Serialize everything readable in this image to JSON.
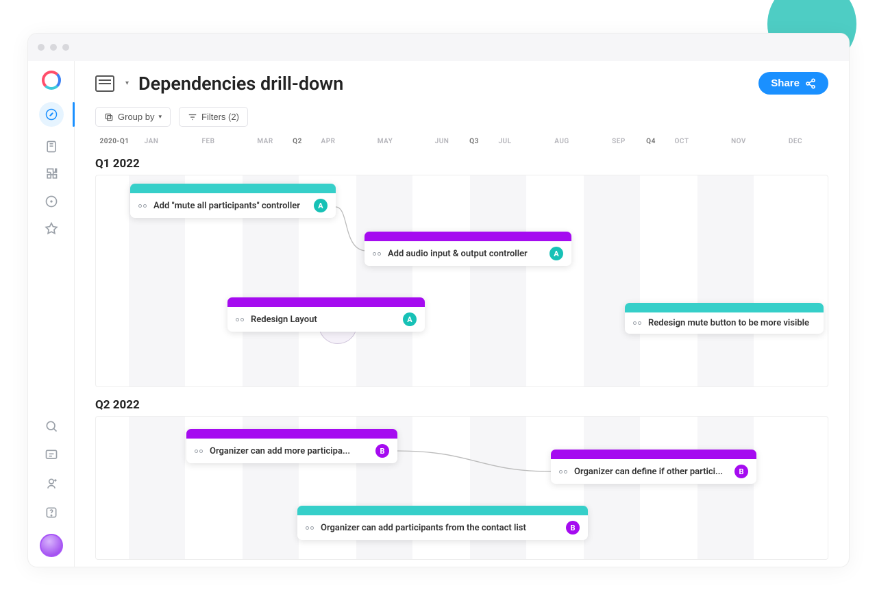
{
  "page": {
    "title": "Dependencies drill-down"
  },
  "share": {
    "label": "Share"
  },
  "toolbar": {
    "group_by": "Group by",
    "filters": "Filters (2)"
  },
  "timeline": {
    "year_label": "2020-Q1",
    "months": [
      "JAN",
      "FEB",
      "MAR",
      "APR",
      "MAY",
      "JUN",
      "JUL",
      "AUG",
      "SEP",
      "OCT",
      "NOV",
      "DEC"
    ],
    "quarters": [
      "Q2",
      "Q3",
      "Q4"
    ]
  },
  "sections": {
    "q1": {
      "label": "Q1 2022"
    },
    "q2": {
      "label": "Q2 2022"
    }
  },
  "cards": {
    "c1": {
      "title": "Add \"mute all participants\" controller",
      "badge": "A"
    },
    "c2": {
      "title": "Add audio input & output controller",
      "badge": "A"
    },
    "c3": {
      "title": "Redesign Layout",
      "badge": "A"
    },
    "c4": {
      "title": "Redesign mute button to be more visible"
    },
    "c5": {
      "title": "Organizer can add more participa...",
      "badge": "B"
    },
    "c6": {
      "title": "Organizer can define if other partici...",
      "badge": "B"
    },
    "c7": {
      "title": "Organizer can add participants from the contact list",
      "badge": "B"
    }
  },
  "colors": {
    "teal": "#36cfc9",
    "purple": "#a50bf0",
    "primary": "#1a90ff"
  }
}
